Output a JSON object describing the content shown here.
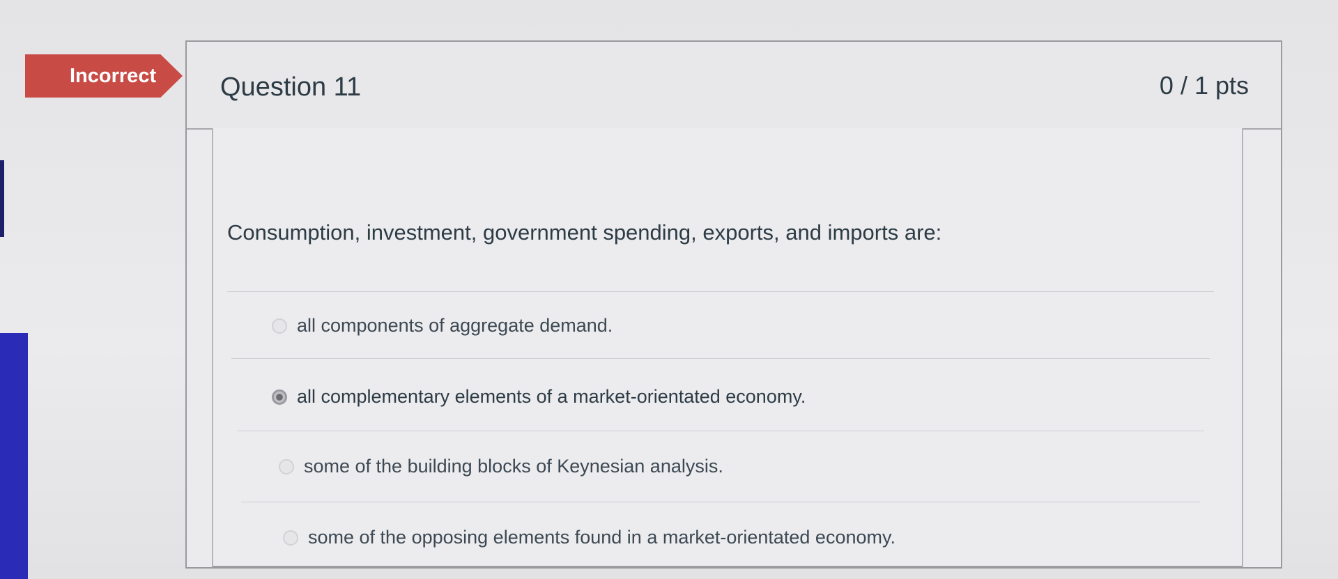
{
  "status": {
    "label": "Incorrect",
    "color": "#c94b45"
  },
  "question": {
    "title": "Question 11",
    "points": "0 / 1 pts",
    "text": "Consumption, investment, government spending, exports, and imports are:"
  },
  "answers": [
    {
      "label": "all components of aggregate demand.",
      "selected": false
    },
    {
      "label": "all complementary elements of a market-orientated economy.",
      "selected": true
    },
    {
      "label": "some of the building blocks of Keynesian analysis.",
      "selected": false
    },
    {
      "label": "some of the opposing elements found in a market-orientated economy.",
      "selected": false
    }
  ],
  "icons": {
    "radio": "radio-button-icon"
  }
}
